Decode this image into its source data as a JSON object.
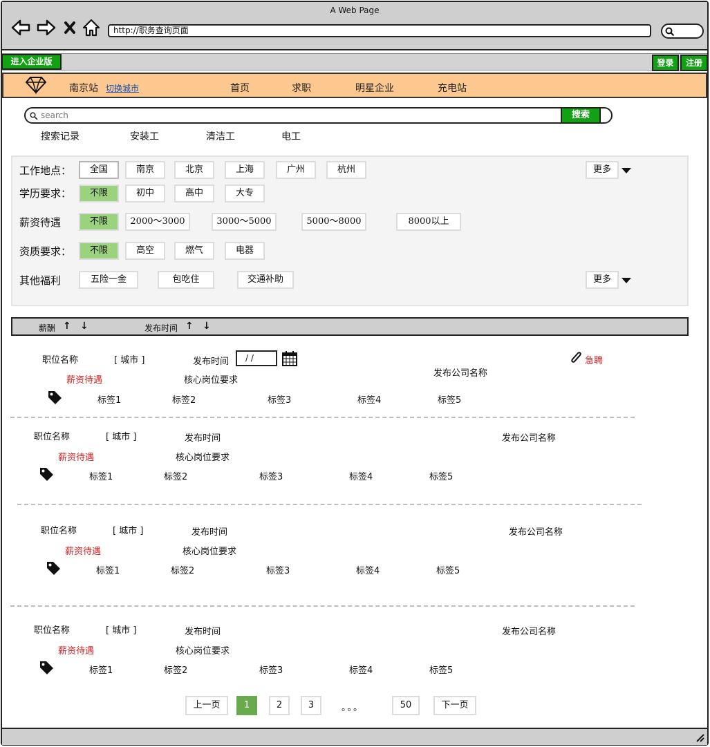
{
  "window": {
    "title": "A Web Page"
  },
  "browser": {
    "url": "http://职务查询页面"
  },
  "topbar": {
    "enterprise_label": "进入企业版",
    "login_label": "登录",
    "register_label": "注册"
  },
  "nav": {
    "city": "南京站",
    "switch_city": "切换城市",
    "items": [
      "首页",
      "求职",
      "明星企业",
      "充电站"
    ]
  },
  "search": {
    "placeholder": "search",
    "button_label": "搜索",
    "quick_links": [
      "搜索记录",
      "安装工",
      "清洁工",
      "电工"
    ]
  },
  "filters": {
    "location": {
      "label": "工作地点：",
      "options": [
        "全国",
        "南京",
        "北京",
        "上海",
        "广州",
        "杭州"
      ],
      "selected": "全国",
      "more": "更多"
    },
    "education": {
      "label": "学历要求：",
      "options": [
        "不限",
        "初中",
        "高中",
        "大专"
      ],
      "selected": "不限"
    },
    "salary": {
      "label": "薪资待遇",
      "options": [
        "不限",
        "2000～3000",
        "3000～5000",
        "5000～8000",
        "8000以上"
      ],
      "selected": "不限"
    },
    "qualification": {
      "label": "资质要求：",
      "options": [
        "不限",
        "高空",
        "燃气",
        "电器"
      ],
      "selected": "不限"
    },
    "benefits": {
      "label": "其他福利",
      "options": [
        "五险一金",
        "包吃住",
        "交通补助"
      ],
      "more": "更多"
    }
  },
  "sort": {
    "salary_label": "薪酬",
    "time_label": "发布时间"
  },
  "jobs": [
    {
      "title": "职位名称",
      "city": "[ 城市 ]",
      "time_label": "发布时间",
      "date_value": "/  /",
      "urgent": "急聘",
      "company": "发布公司名称",
      "salary": "薪资待遇",
      "requirement": "核心岗位要求",
      "tags": [
        "标签1",
        "标签2",
        "标签3",
        "标签4",
        "标签5"
      ]
    },
    {
      "title": "职位名称",
      "city": "[ 城市 ]",
      "time_label": "发布时间",
      "company": "发布公司名称",
      "salary": "薪资待遇",
      "requirement": "核心岗位要求",
      "tags": [
        "标签1",
        "标签2",
        "标签3",
        "标签4",
        "标签5"
      ]
    },
    {
      "title": "职位名称",
      "city": "[ 城市 ]",
      "time_label": "发布时间",
      "company": "发布公司名称",
      "salary": "薪资待遇",
      "requirement": "核心岗位要求",
      "tags": [
        "标签1",
        "标签2",
        "标签3",
        "标签4",
        "标签5"
      ]
    },
    {
      "title": "职位名称",
      "city": "[ 城市 ]",
      "time_label": "发布时间",
      "company": "发布公司名称",
      "salary": "薪资待遇",
      "requirement": "核心岗位要求",
      "tags": [
        "标签1",
        "标签2",
        "标签3",
        "标签4",
        "标签5"
      ]
    }
  ],
  "pagination": {
    "prev": "上一页",
    "pages": [
      "1",
      "2",
      "3"
    ],
    "ellipsis": "。。。",
    "last": "50",
    "next": "下一页",
    "current": "1"
  },
  "icons": {
    "back": "arrow-left-icon",
    "forward": "arrow-right-icon",
    "stop": "close-icon",
    "home": "home-icon",
    "search": "search-icon",
    "logo": "diamond-icon",
    "sort_up": "arrow-up-icon",
    "sort_down": "arrow-down-icon",
    "tag": "tag-icon",
    "calendar": "calendar-icon",
    "attach": "paperclip-icon",
    "dropdown": "triangle-down-icon",
    "resize": "resize-grip-icon"
  },
  "colors": {
    "brand_green": "#12a112",
    "nav_orange": "#fcc88f",
    "selected_chip": "#9bd27e",
    "current_page": "#6aaa4f",
    "urgent_red": "#d11f1f"
  }
}
